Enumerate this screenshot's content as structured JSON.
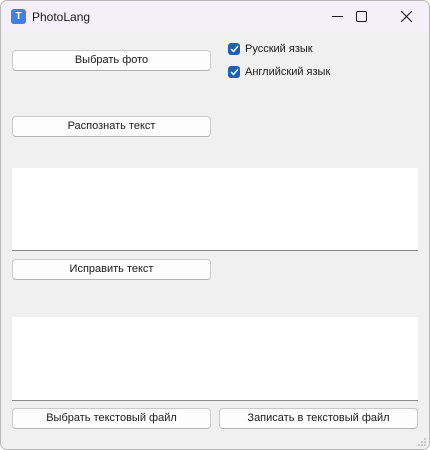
{
  "window": {
    "title": "PhotoLang",
    "icon_letter": "T"
  },
  "controls": {
    "choose_photo_label": "Выбрать фото",
    "recognize_text_label": "Распознать текст",
    "fix_text_label": "Исправить текст",
    "choose_text_file_label": "Выбрать текстовый файл",
    "write_text_file_label": "Записать в текстовый файл"
  },
  "languages": [
    {
      "label": "Русский язык",
      "checked": true
    },
    {
      "label": "Английский язык",
      "checked": true
    }
  ],
  "recognized_text": "",
  "corrected_text": "",
  "colors": {
    "accent": "#1f5fb6",
    "app_icon": "#3f7fe6"
  }
}
